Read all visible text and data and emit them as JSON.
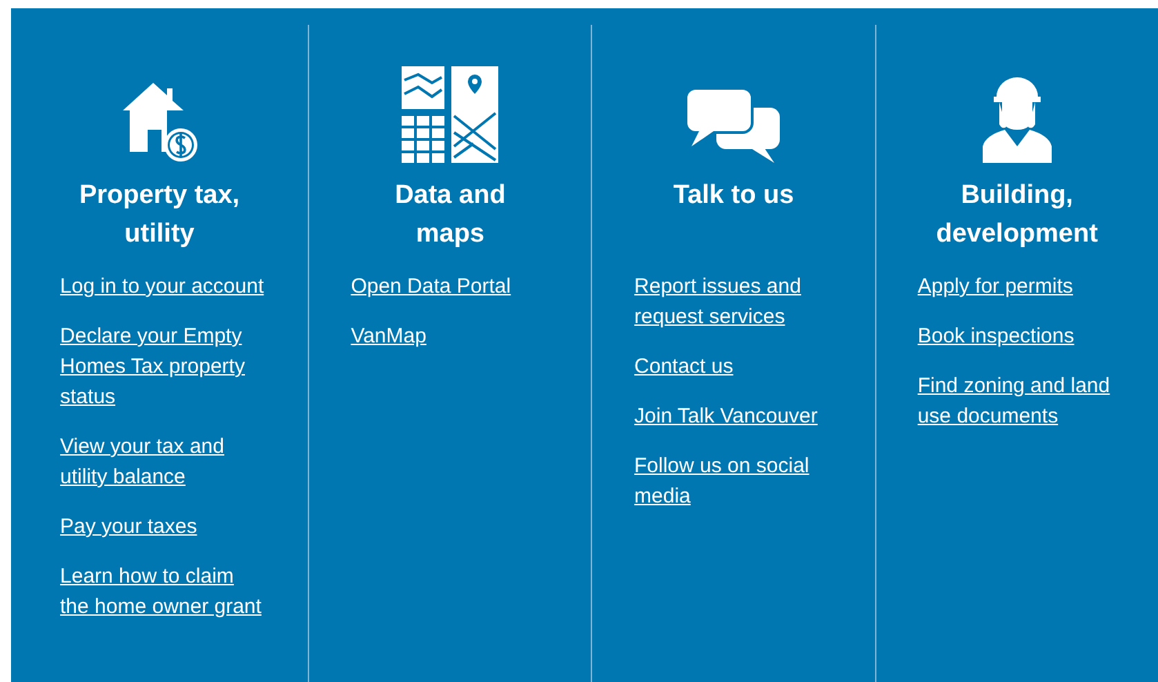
{
  "columns": [
    {
      "title": "Property tax, utility",
      "links": [
        "Log in to your account",
        "Declare your Empty Homes Tax property status",
        "View your tax and utility balance",
        "Pay your taxes",
        "Learn how to claim the home owner grant"
      ]
    },
    {
      "title": "Data and maps",
      "links": [
        "Open Data Portal",
        "VanMap"
      ]
    },
    {
      "title": "Talk to us",
      "links": [
        "Report issues and request services",
        "Contact us",
        "Join Talk Vancouver",
        "Follow us on social media"
      ]
    },
    {
      "title": "Building, development",
      "links": [
        "Apply for permits",
        "Book inspections",
        "Find zoning and land use documents"
      ]
    }
  ]
}
